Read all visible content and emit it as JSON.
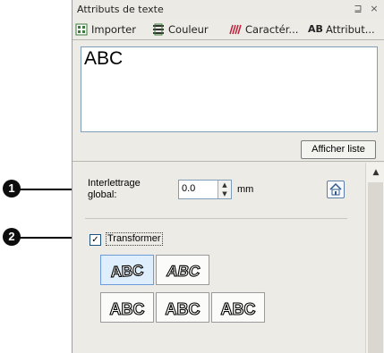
{
  "window": {
    "title": "Attributs de texte",
    "pin_glyph": "⊒",
    "close_glyph": "×"
  },
  "tabs": [
    {
      "label": "Importer",
      "icon": "import-icon"
    },
    {
      "label": "Couleur",
      "icon": "color-icon"
    },
    {
      "label": "Caractér...",
      "icon": "characters-icon"
    },
    {
      "label": "Attribut...",
      "icon_text": "AB",
      "active": true
    }
  ],
  "preview": {
    "text": "ABC"
  },
  "show_list_button": "Afficher liste",
  "spacing": {
    "label_line1": "Interlettrage",
    "label_line2": "global:",
    "value": "0.0",
    "unit": "mm"
  },
  "transform": {
    "checked": true,
    "label": "Transformer"
  },
  "shapes_row1": [
    {
      "text": "ABC",
      "shape": "arch",
      "selected": true
    },
    {
      "text": "ABC",
      "shape": "wave",
      "selected": false
    }
  ],
  "shapes_row2": [
    {
      "text": "ABC",
      "shape": "straight",
      "selected": false
    },
    {
      "text": "ABC",
      "shape": "valley",
      "selected": false
    },
    {
      "text": "ABC",
      "shape": "bulge",
      "selected": false
    }
  ],
  "callouts": [
    {
      "number": "1"
    },
    {
      "number": "2"
    }
  ],
  "colors": {
    "panel_bg": "#ecebe6",
    "selected_shape": "#dfeefc",
    "accent_border": "#6b9bd8"
  }
}
